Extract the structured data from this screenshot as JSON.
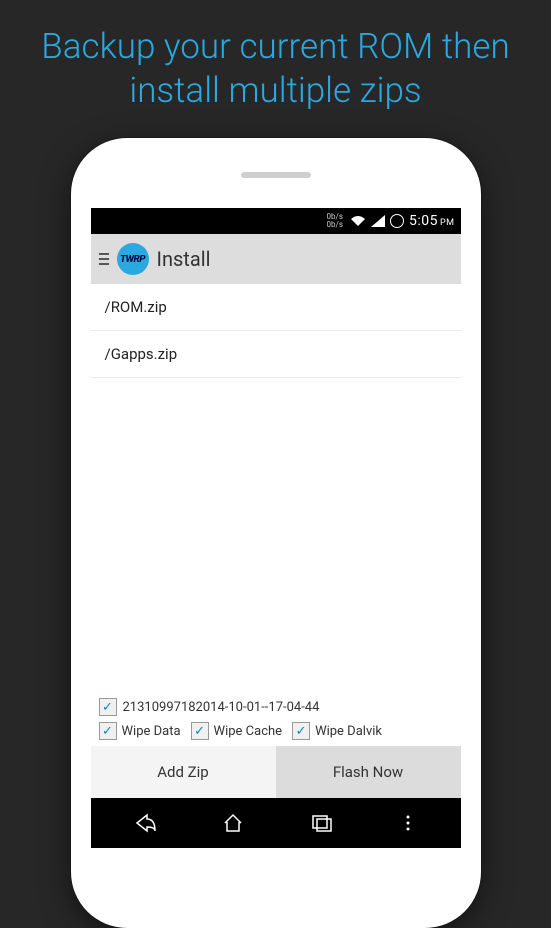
{
  "headline": "Backup your current ROM then install multiple zips",
  "statusbar": {
    "net_speed_line1": "0b/s",
    "net_speed_line2": "0b/s",
    "time": "5:05",
    "ampm": "PM"
  },
  "actionbar": {
    "logo_text": "TWRP",
    "title": "Install"
  },
  "files": {
    "item0": "/ROM.zip",
    "item1": "/Gapps.zip"
  },
  "backup": {
    "label": "213109971820​14-10-01--17-04-44"
  },
  "wipe": {
    "data": "Wipe Data",
    "cache": "Wipe Cache",
    "dalvik": "Wipe Dalvik"
  },
  "buttons": {
    "add": "Add Zip",
    "flash": "Flash Now"
  }
}
